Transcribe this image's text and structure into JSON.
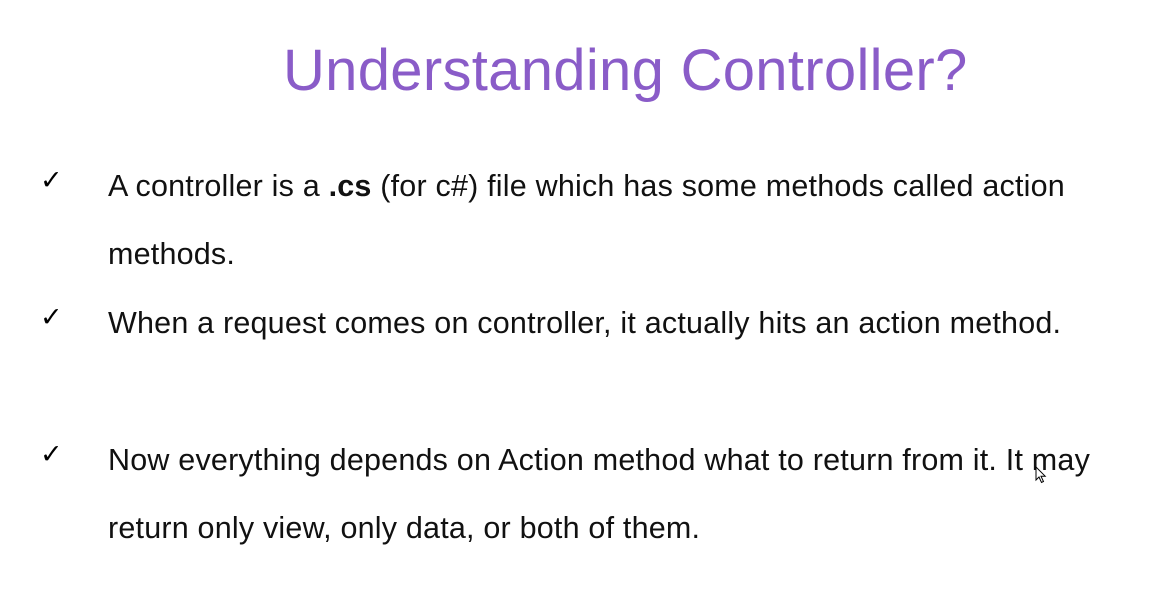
{
  "slide": {
    "title": "Understanding Controller?",
    "bullets": [
      {
        "check_icon": "checkmark-icon",
        "text_before": "A controller is a ",
        "bold": ".cs",
        "text_after": " (for c#) file which has some methods called action methods."
      },
      {
        "check_icon": "checkmark-icon",
        "text": "When a request comes on controller, it actually hits an action method."
      },
      {
        "check_icon": "checkmark-icon",
        "text": "Now everything depends on Action method what to return from it. It may return only view, only data, or both of them."
      }
    ],
    "check_glyph": "✓",
    "colors": {
      "title": "#8a5cc8",
      "text": "#111111"
    }
  }
}
